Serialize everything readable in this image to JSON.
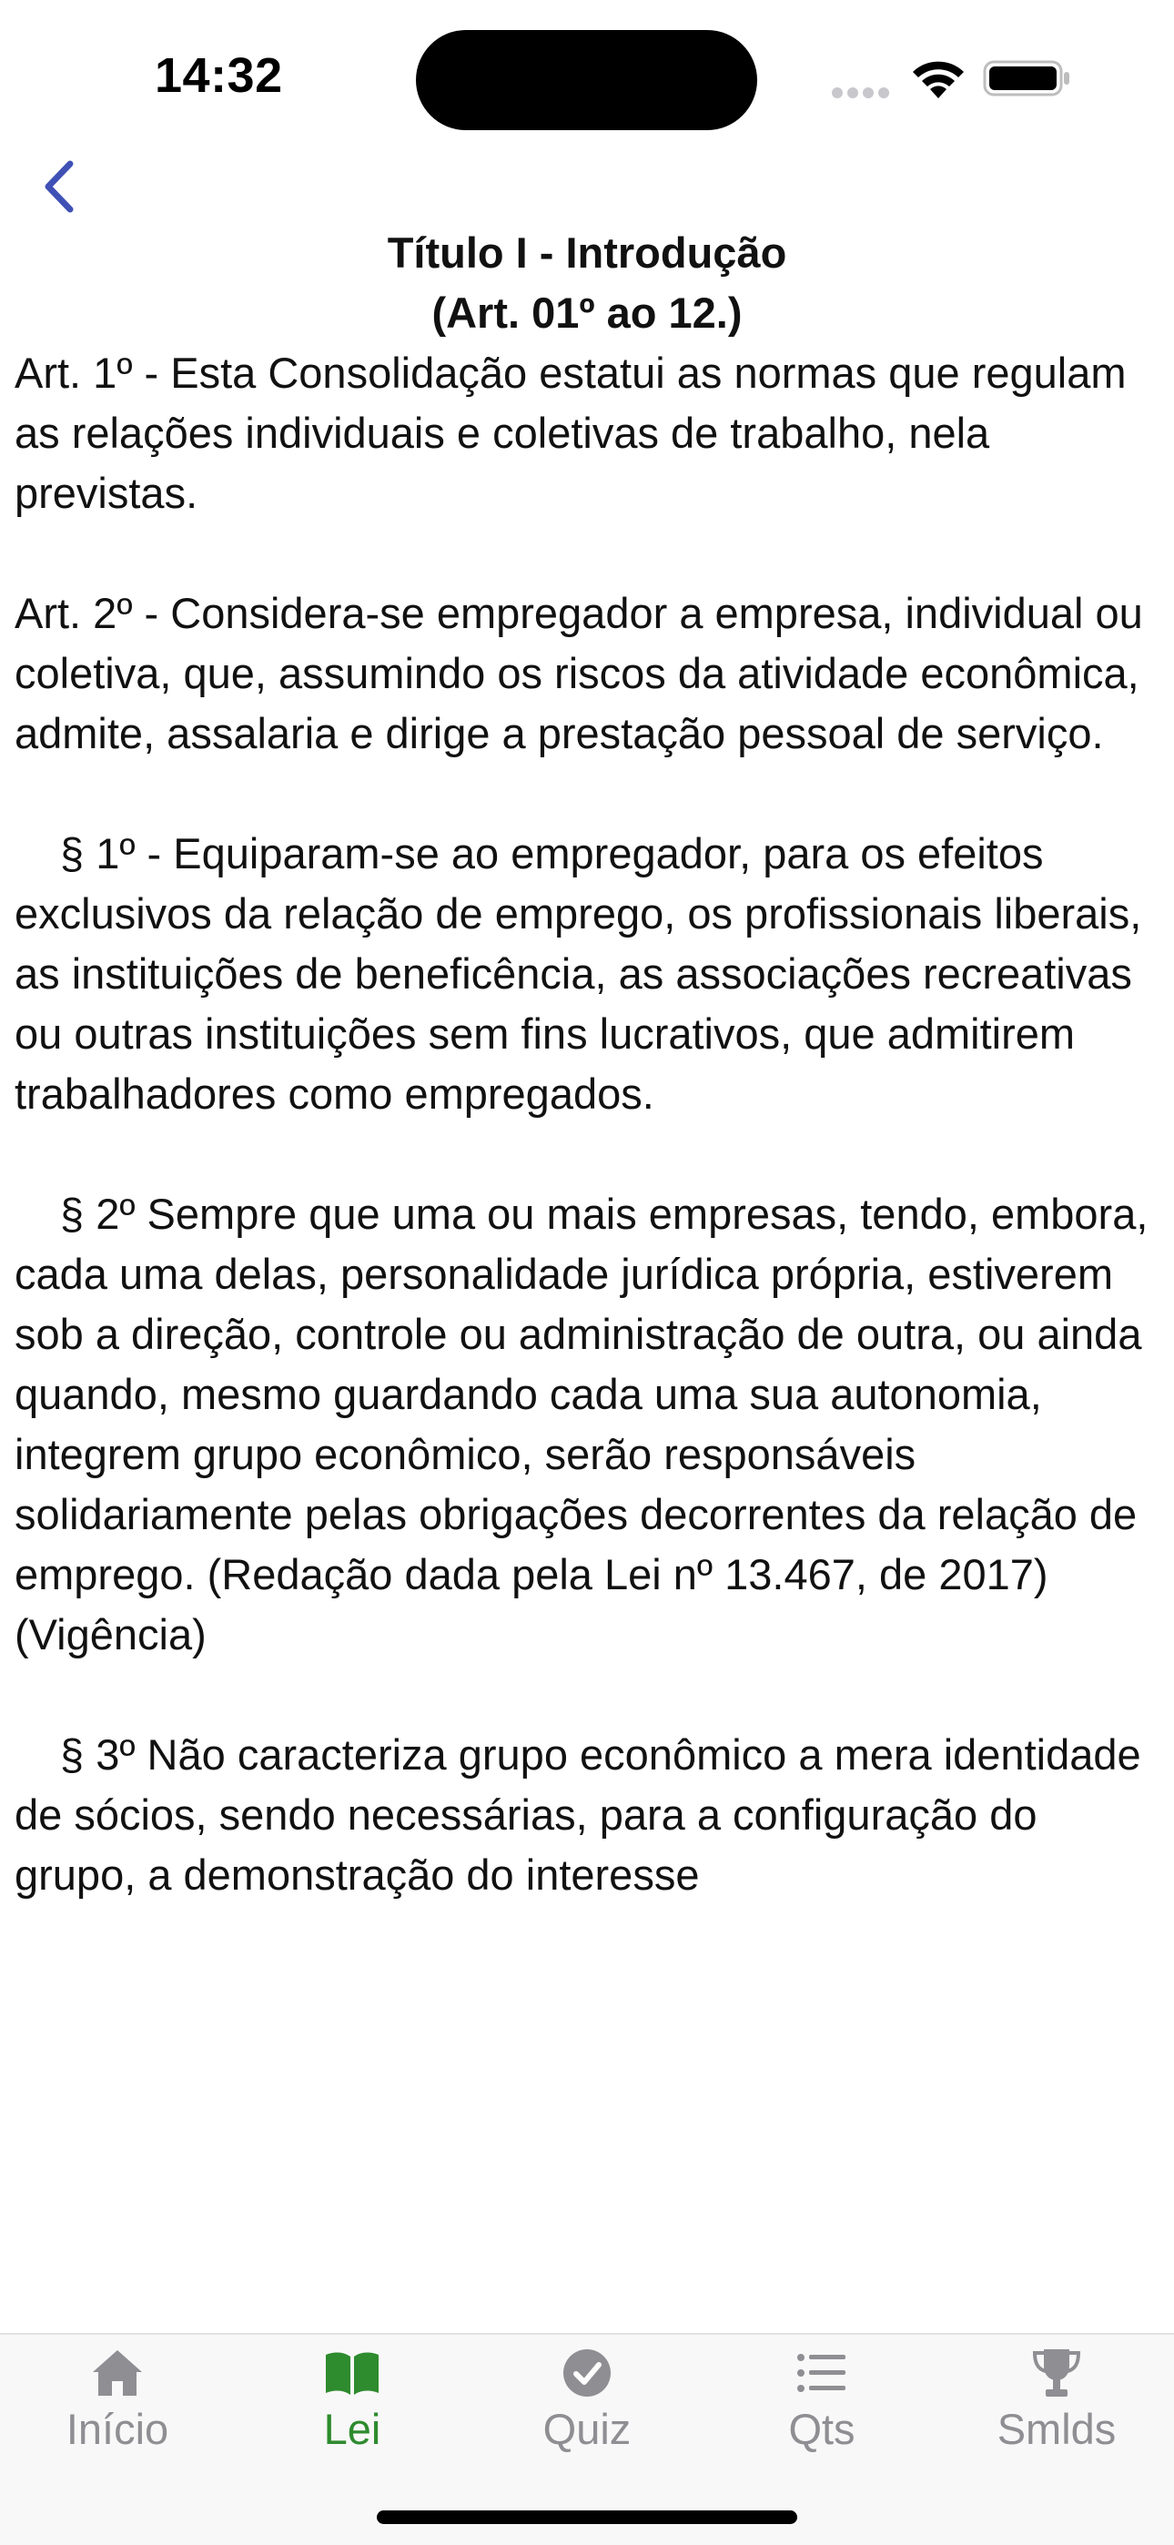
{
  "status_bar": {
    "time": "14:32"
  },
  "nav": {
    "back_icon": "chevron-left-icon"
  },
  "header": {
    "title": "Título I - Introdução",
    "subtitle": "(Art. 01º ao 12.)"
  },
  "law": {
    "paragraphs": [
      "Art. 1º - Esta Consolidação estatui as normas que regulam as relações individuais e coletivas de trabalho, nela previstas.",
      "Art. 2º - Considera-se empregador a empresa, individual ou coletiva, que, assumindo os riscos da atividade econômica, admite, assalaria e dirige a prestação pessoal de serviço.",
      "§ 1º - Equiparam-se ao empregador, para os efeitos exclusivos da relação de emprego, os profissionais liberais, as instituições de beneficência, as associações recreativas ou outras instituições sem fins lucrativos, que admitirem trabalhadores como empregados.",
      "§ 2º Sempre que uma ou mais empresas, tendo, embora, cada uma delas, personalidade jurídica própria, estiverem sob a direção, controle ou administração de outra, ou ainda quando, mesmo guardando cada uma sua autonomia, integrem grupo econômico, serão responsáveis solidariamente pelas obrigações decorrentes da relação de emprego. (Redação dada pela Lei nº 13.467, de 2017) (Vigência)",
      "§ 3º Não caracteriza grupo econômico a mera identidade de sócios, sendo necessárias, para a configuração do grupo, a demonstração do interesse"
    ]
  },
  "tabs": [
    {
      "label": "Início",
      "icon": "home-icon",
      "active": false
    },
    {
      "label": "Lei",
      "icon": "book-icon",
      "active": true
    },
    {
      "label": "Quiz",
      "icon": "checkmark-circle-icon",
      "active": false
    },
    {
      "label": "Qts",
      "icon": "list-icon",
      "active": false
    },
    {
      "label": "Smlds",
      "icon": "trophy-icon",
      "active": false
    }
  ],
  "colors": {
    "accent": "#2e8b2e",
    "back_chevron": "#3f51b5",
    "inactive_tab": "#8e8e93"
  }
}
